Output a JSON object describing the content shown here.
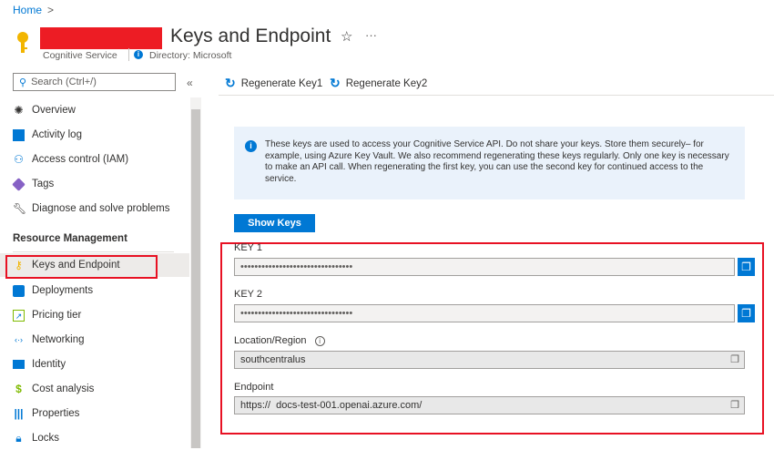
{
  "breadcrumb": {
    "home": "Home",
    "separator": ">"
  },
  "header": {
    "title": "Keys and Endpoint",
    "resource_type": "Cognitive Service",
    "directory": "Directory: Microsoft"
  },
  "search": {
    "placeholder": "Search (Ctrl+/)"
  },
  "collapse": "«",
  "toolbar": {
    "regen1": "Regenerate Key1",
    "regen2": "Regenerate Key2"
  },
  "sidebar": {
    "items": [
      {
        "label": "Overview",
        "icon": "openai-icon"
      },
      {
        "label": "Activity log",
        "icon": "activity-log-icon"
      },
      {
        "label": "Access control (IAM)",
        "icon": "people-icon"
      },
      {
        "label": "Tags",
        "icon": "tag-icon"
      },
      {
        "label": "Diagnose and solve problems",
        "icon": "wrench-icon"
      }
    ],
    "section": "Resource Management",
    "section_items": [
      {
        "label": "Keys and Endpoint",
        "icon": "key-icon"
      },
      {
        "label": "Deployments",
        "icon": "cube-icon"
      },
      {
        "label": "Pricing tier",
        "icon": "pricing-icon"
      },
      {
        "label": "Networking",
        "icon": "network-icon"
      },
      {
        "label": "Identity",
        "icon": "identity-icon"
      },
      {
        "label": "Cost analysis",
        "icon": "cost-icon"
      },
      {
        "label": "Properties",
        "icon": "properties-icon"
      },
      {
        "label": "Locks",
        "icon": "lock-icon"
      }
    ]
  },
  "info": "These keys are used to access your Cognitive Service API. Do not share your keys. Store them securely– for example, using Azure Key Vault. We also recommend regenerating these keys regularly. Only one key is necessary to make an API call. When regenerating the first key, you can use the second key for continued access to the service.",
  "show_keys": "Show Keys",
  "fields": {
    "key1_label": "KEY 1",
    "key1_value": "••••••••••••••••••••••••••••••••",
    "key2_label": "KEY 2",
    "key2_value": "••••••••••••••••••••••••••••••••",
    "location_label": "Location/Region",
    "location_value": "southcentralus",
    "endpoint_label": "Endpoint",
    "endpoint_value": "https://  docs-test-001.openai.azure.com/"
  }
}
